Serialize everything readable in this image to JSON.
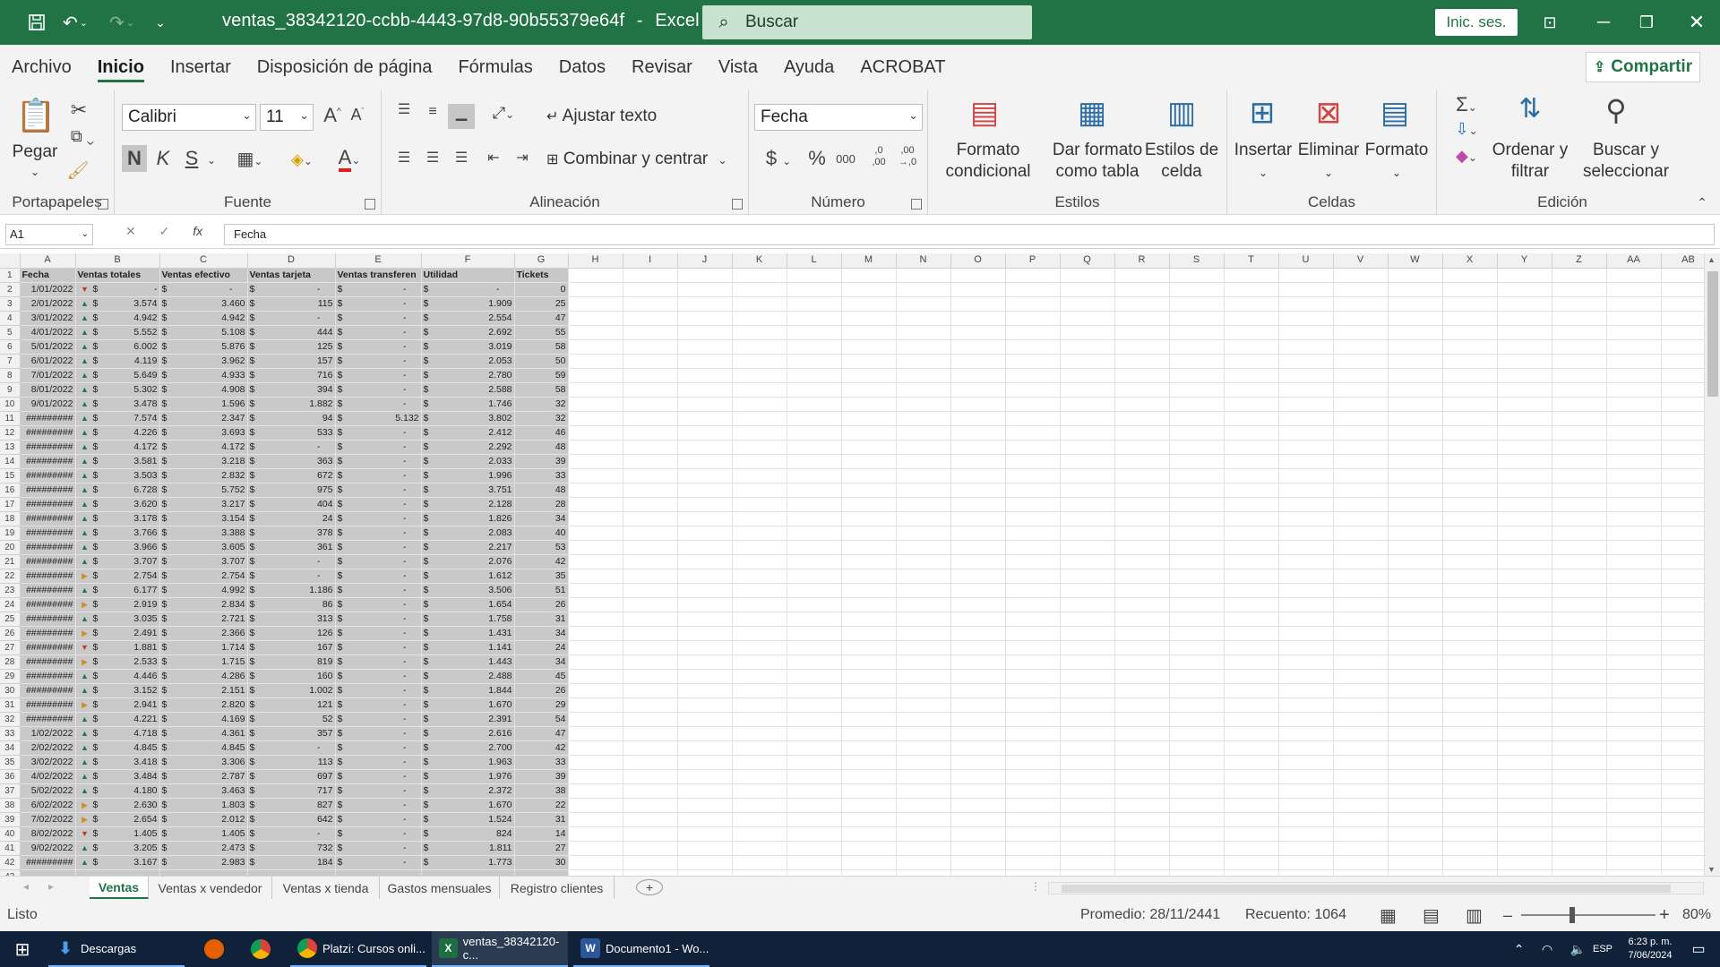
{
  "titlebar": {
    "filename": "ventas_38342120-ccbb-4443-97d8-90b55379e64f",
    "app": "Excel",
    "search_placeholder": "Buscar",
    "signin_label": "Inic. ses."
  },
  "menu": {
    "items": [
      "Archivo",
      "Inicio",
      "Insertar",
      "Disposición de página",
      "Fórmulas",
      "Datos",
      "Revisar",
      "Vista",
      "Ayuda",
      "ACROBAT"
    ],
    "active": "Inicio",
    "share_label": "Compartir"
  },
  "ribbon": {
    "clipboard": {
      "label": "Portapapeles",
      "paste": "Pegar"
    },
    "font": {
      "label": "Fuente",
      "font_name": "Calibri",
      "font_size": "11",
      "bold": "N",
      "italic": "K",
      "underline": "S",
      "increase": "A",
      "decrease": "A"
    },
    "alignment": {
      "label": "Alineación",
      "wrap_text": "Ajustar texto",
      "merge_center": "Combinar y centrar"
    },
    "number": {
      "label": "Número",
      "format": "Fecha",
      "currency": "$",
      "percent": "%",
      "thousands": "000",
      "inc_decimals": ",0\n,00",
      "dec_decimals": ",00\n→,0"
    },
    "styles": {
      "label": "Estilos",
      "conditional": "Formato\ncondicional",
      "as_table": "Dar formato\ncomo tabla",
      "cell_styles": "Estilos de\ncelda"
    },
    "cells": {
      "label": "Celdas",
      "insert": "Insertar",
      "delete": "Eliminar",
      "format": "Formato"
    },
    "editing": {
      "label": "Edición",
      "sort_filter": "Ordenar y\nfiltrar",
      "find_select": "Buscar y\nseleccionar"
    }
  },
  "formula_bar": {
    "name_box": "A1",
    "value": "Fecha",
    "fx": "fx"
  },
  "sheet": {
    "column_letters": [
      "A",
      "B",
      "C",
      "D",
      "E",
      "F",
      "G",
      "H",
      "I",
      "J",
      "K",
      "L",
      "M",
      "N",
      "O",
      "P",
      "Q",
      "R",
      "S",
      "T",
      "U",
      "V",
      "W",
      "X",
      "Y",
      "Z",
      "AA",
      "AB"
    ],
    "headers": [
      "Fecha",
      "Ventas totales",
      "Ventas efectivo",
      "Ventas tarjeta",
      "Ventas transferen",
      "Utilidad",
      "Tickets"
    ],
    "currency_symbol": "$",
    "rows": [
      [
        "1/01/2022",
        "down",
        "-",
        "-",
        "-",
        "-",
        "-",
        "0"
      ],
      [
        "2/01/2022",
        "up",
        "3.574",
        "3.460",
        "115",
        "-",
        "1.909",
        "25"
      ],
      [
        "3/01/2022",
        "up",
        "4.942",
        "4.942",
        "-",
        "-",
        "2.554",
        "47"
      ],
      [
        "4/01/2022",
        "up",
        "5.552",
        "5.108",
        "444",
        "-",
        "2.692",
        "55"
      ],
      [
        "5/01/2022",
        "up",
        "6.002",
        "5.876",
        "125",
        "-",
        "3.019",
        "58"
      ],
      [
        "6/01/2022",
        "up",
        "4.119",
        "3.962",
        "157",
        "-",
        "2.053",
        "50"
      ],
      [
        "7/01/2022",
        "up",
        "5.649",
        "4.933",
        "716",
        "-",
        "2.780",
        "59"
      ],
      [
        "8/01/2022",
        "up",
        "5.302",
        "4.908",
        "394",
        "-",
        "2.588",
        "58"
      ],
      [
        "9/01/2022",
        "up",
        "3.478",
        "1.596",
        "1.882",
        "-",
        "1.746",
        "32"
      ],
      [
        "#########",
        "up",
        "7.574",
        "2.347",
        "94",
        "5.132",
        "3.802",
        "32"
      ],
      [
        "#########",
        "up",
        "4.226",
        "3.693",
        "533",
        "-",
        "2.412",
        "46"
      ],
      [
        "#########",
        "up",
        "4.172",
        "4.172",
        "-",
        "-",
        "2.292",
        "48"
      ],
      [
        "#########",
        "up",
        "3.581",
        "3.218",
        "363",
        "-",
        "2.033",
        "39"
      ],
      [
        "#########",
        "up",
        "3.503",
        "2.832",
        "672",
        "-",
        "1.996",
        "33"
      ],
      [
        "#########",
        "up",
        "6.728",
        "5.752",
        "975",
        "-",
        "3.751",
        "48"
      ],
      [
        "#########",
        "up",
        "3.620",
        "3.217",
        "404",
        "-",
        "2.128",
        "28"
      ],
      [
        "#########",
        "up",
        "3.178",
        "3.154",
        "24",
        "-",
        "1.826",
        "34"
      ],
      [
        "#########",
        "up",
        "3.766",
        "3.388",
        "378",
        "-",
        "2.083",
        "40"
      ],
      [
        "#########",
        "up",
        "3.966",
        "3.605",
        "361",
        "-",
        "2.217",
        "53"
      ],
      [
        "#########",
        "up",
        "3.707",
        "3.707",
        "-",
        "-",
        "2.076",
        "42"
      ],
      [
        "#########",
        "side",
        "2.754",
        "2.754",
        "-",
        "-",
        "1.612",
        "35"
      ],
      [
        "#########",
        "up",
        "6.177",
        "4.992",
        "1.186",
        "-",
        "3.506",
        "51"
      ],
      [
        "#########",
        "side",
        "2.919",
        "2.834",
        "86",
        "-",
        "1.654",
        "26"
      ],
      [
        "#########",
        "up",
        "3.035",
        "2.721",
        "313",
        "-",
        "1.758",
        "31"
      ],
      [
        "#########",
        "side",
        "2.491",
        "2.366",
        "126",
        "-",
        "1.431",
        "34"
      ],
      [
        "#########",
        "down",
        "1.881",
        "1.714",
        "167",
        "-",
        "1.141",
        "24"
      ],
      [
        "#########",
        "side",
        "2.533",
        "1.715",
        "819",
        "-",
        "1.443",
        "34"
      ],
      [
        "#########",
        "up",
        "4.446",
        "4.286",
        "160",
        "-",
        "2.488",
        "45"
      ],
      [
        "#########",
        "up",
        "3.152",
        "2.151",
        "1.002",
        "-",
        "1.844",
        "26"
      ],
      [
        "#########",
        "side",
        "2.941",
        "2.820",
        "121",
        "-",
        "1.670",
        "29"
      ],
      [
        "#########",
        "up",
        "4.221",
        "4.169",
        "52",
        "-",
        "2.391",
        "54"
      ],
      [
        "1/02/2022",
        "up",
        "4.718",
        "4.361",
        "357",
        "-",
        "2.616",
        "47"
      ],
      [
        "2/02/2022",
        "up",
        "4.845",
        "4.845",
        "-",
        "-",
        "2.700",
        "42"
      ],
      [
        "3/02/2022",
        "up",
        "3.418",
        "3.306",
        "113",
        "-",
        "1.963",
        "33"
      ],
      [
        "4/02/2022",
        "up",
        "3.484",
        "2.787",
        "697",
        "-",
        "1.976",
        "39"
      ],
      [
        "5/02/2022",
        "up",
        "4.180",
        "3.463",
        "717",
        "-",
        "2.372",
        "38"
      ],
      [
        "6/02/2022",
        "side",
        "2.630",
        "1.803",
        "827",
        "-",
        "1.670",
        "22"
      ],
      [
        "7/02/2022",
        "side",
        "2.654",
        "2.012",
        "642",
        "-",
        "1.524",
        "31"
      ],
      [
        "8/02/2022",
        "down",
        "1.405",
        "1.405",
        "-",
        "-",
        "824",
        "14"
      ],
      [
        "9/02/2022",
        "up",
        "3.205",
        "2.473",
        "732",
        "-",
        "1.811",
        "27"
      ],
      [
        "#########",
        "up",
        "3.167",
        "2.983",
        "184",
        "-",
        "1.773",
        "30"
      ]
    ],
    "partial_row_number": "43"
  },
  "sheet_tabs": {
    "tabs": [
      "Ventas",
      "Ventas x vendedor",
      "Ventas x tienda",
      "Gastos mensuales",
      "Registro clientes"
    ],
    "active": "Ventas",
    "add": "+"
  },
  "statusbar": {
    "mode": "Listo",
    "average": "Promedio: 28/11/2441",
    "count": "Recuento: 1064",
    "zoom": "80%",
    "zoom_minus": "–",
    "zoom_plus": "+"
  },
  "taskbar": {
    "items": [
      {
        "label": "Descargas",
        "icon": "folder-download-icon"
      },
      {
        "label": "",
        "icon": "firefox-icon"
      },
      {
        "label": "",
        "icon": "chrome-icon"
      },
      {
        "label": "Platzi: Cursos onli...",
        "icon": "chrome-icon"
      },
      {
        "label": "ventas_38342120-c...",
        "icon": "excel-icon"
      },
      {
        "label": "Documento1 - Wo...",
        "icon": "word-icon"
      }
    ],
    "lang": "ESP",
    "time": "6:23 p. m.",
    "date": "7/06/2024"
  },
  "colors": {
    "excel_green": "#217346",
    "selection_gray": "#c9c9c9",
    "taskbar": "#10223a",
    "trend_up": "#1f7a54",
    "trend_down": "#c0392b",
    "trend_side": "#d68a1c"
  }
}
